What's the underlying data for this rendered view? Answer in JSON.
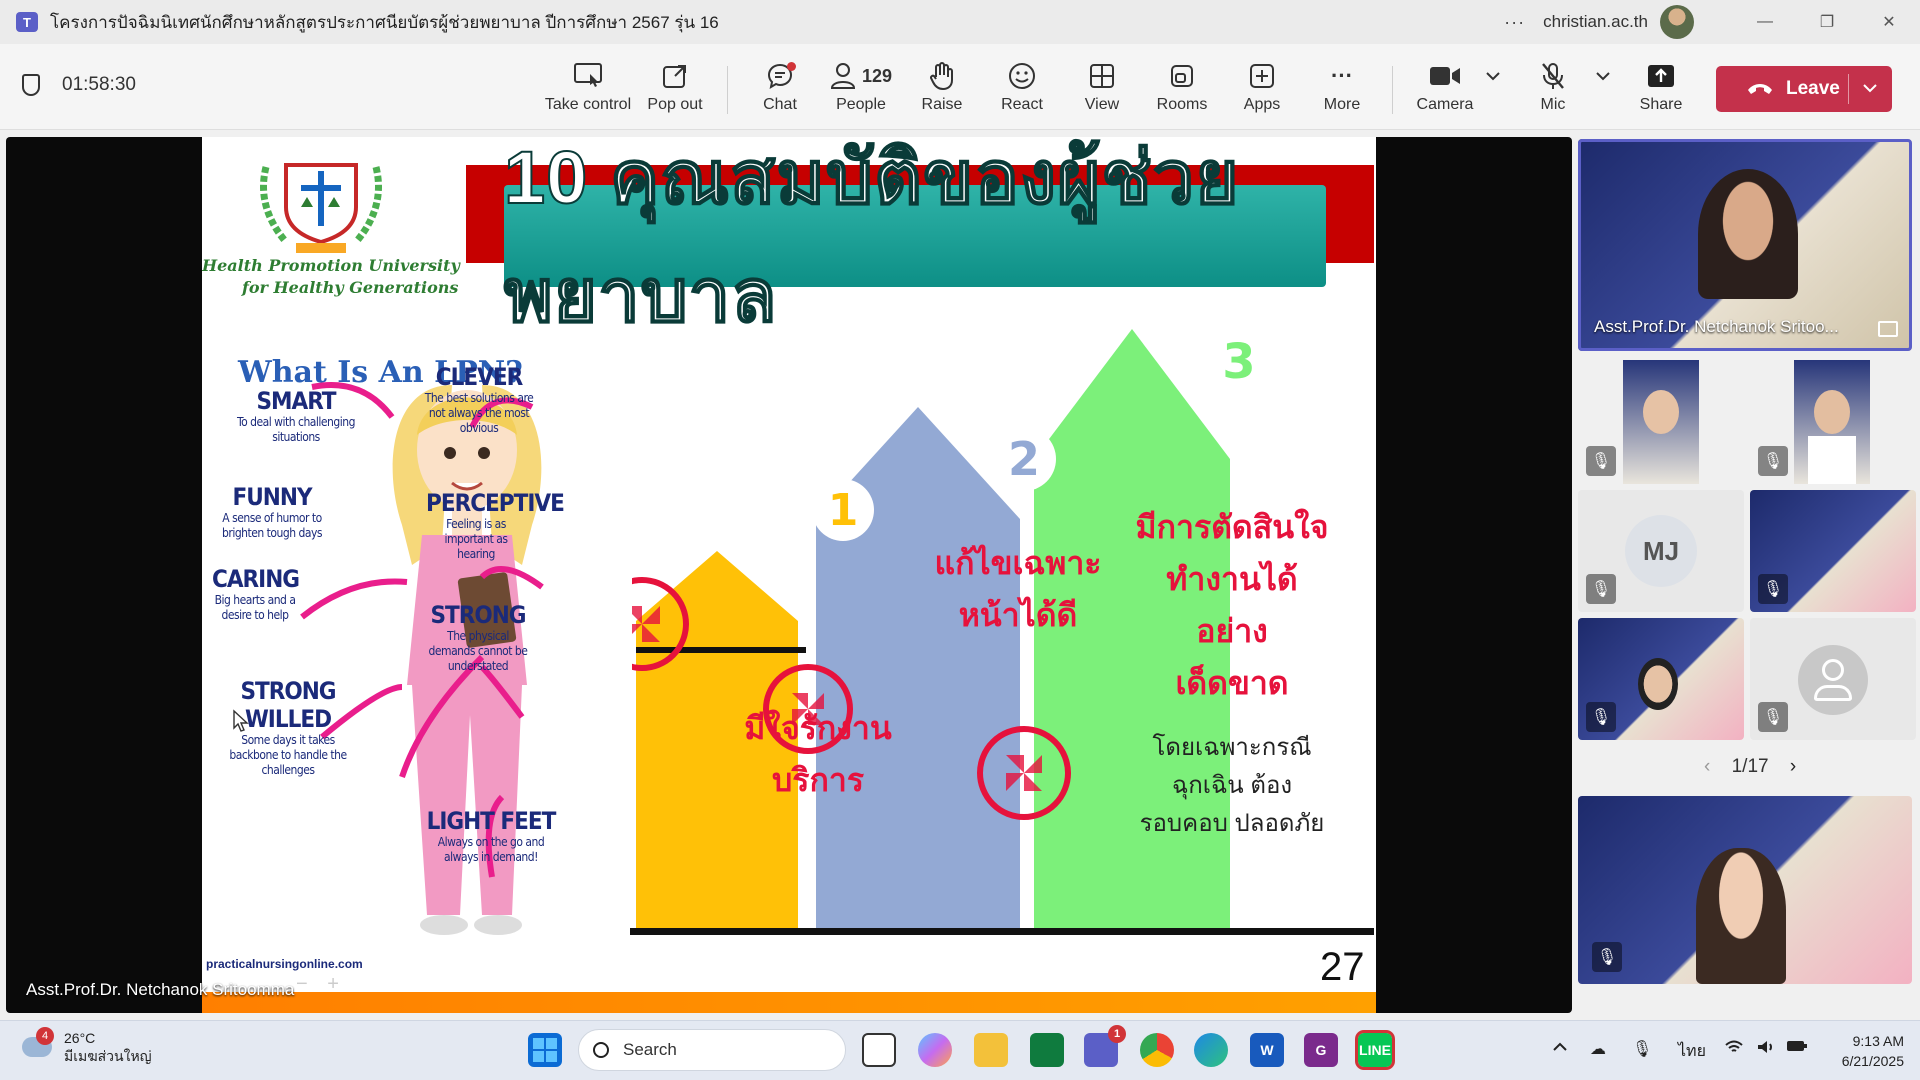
{
  "titlebar": {
    "title": "โครงการปัจฉิมนิเทศนักศึกษาหลักสูตรประกาศนียบัตรผู้ช่วยพยาบาล ปีการศึกษา 2567 รุ่น 16",
    "more": "···",
    "account": "christian.ac.th",
    "minimize": "—",
    "restore": "❐",
    "close": "✕"
  },
  "toolbar": {
    "timer": "01:58:30",
    "take_control": "Take control",
    "pop_out": "Pop out",
    "chat": "Chat",
    "people": "People",
    "people_count": "129",
    "raise": "Raise",
    "react": "React",
    "view": "View",
    "rooms": "Rooms",
    "apps": "Apps",
    "more": "More",
    "camera": "Camera",
    "mic": "Mic",
    "share": "Share",
    "leave": "Leave"
  },
  "slide": {
    "banner": "10 คุณสมบัติของผู้ช่วยพยาบาล",
    "logo_text_1": "Health Promotion University",
    "logo_text_2": "for Healthy Generations",
    "lpn_title": "What Is An LPN?",
    "traits": [
      {
        "head": "SMART",
        "sub": "To deal with challenging situations"
      },
      {
        "head": "CLEVER",
        "sub": "The best solutions are not always the most obvious"
      },
      {
        "head": "FUNNY",
        "sub": "A sense of humor to brighten tough days"
      },
      {
        "head": "PERCEPTIVE",
        "sub": "Feeling is as important as hearing"
      },
      {
        "head": "CARING",
        "sub": "Big hearts and a desire to help"
      },
      {
        "head": "STRONG",
        "sub": "The physical demands cannot be understated"
      },
      {
        "head": "STRONG WILLED",
        "sub": "Some days it takes backbone to handle the challenges"
      },
      {
        "head": "LIGHT FEET",
        "sub": "Always on the go and always in demand!"
      }
    ],
    "site": "practicalnursingonline.com",
    "arrows": [
      {
        "num": "1",
        "text_1": "มีใจรักงาน",
        "text_2": "บริการ"
      },
      {
        "num": "2",
        "text_1": "แก้ไขเฉพาะ",
        "text_2": "หน้าได้ดี"
      },
      {
        "num": "3",
        "text_1": "มีการตัดสินใจ",
        "text_2": "ทำงานได้อย่าง",
        "text_3": "เด็ดขาด",
        "note_1": "โดยเฉพาะกรณี",
        "note_2": "ฉุกเฉิน ต้อง",
        "note_3": "รอบคอบ ปลอดภัย"
      }
    ],
    "page_number": "27"
  },
  "stage": {
    "speaker": "Asst.Prof.Dr. Netchanok Sritoomma"
  },
  "panel": {
    "main_tile_name": "Asst.Prof.Dr. Netchanok Sritoo...",
    "initials": "MJ",
    "pager": "1/17"
  },
  "taskbar": {
    "weather_badge": "4",
    "temperature": "26°C",
    "weather_desc": "มีเมฆส่วนใหญ่",
    "search": "Search",
    "teams_badge": "1",
    "language": "ไทย",
    "time": "9:13 AM",
    "date": "6/21/2025"
  },
  "colors": {
    "accent": "#5b5fc7",
    "leave": "#c4314b",
    "arrow1": "#ffc107",
    "arrow2": "#93a9d4",
    "arrow3": "#7cf07a"
  }
}
